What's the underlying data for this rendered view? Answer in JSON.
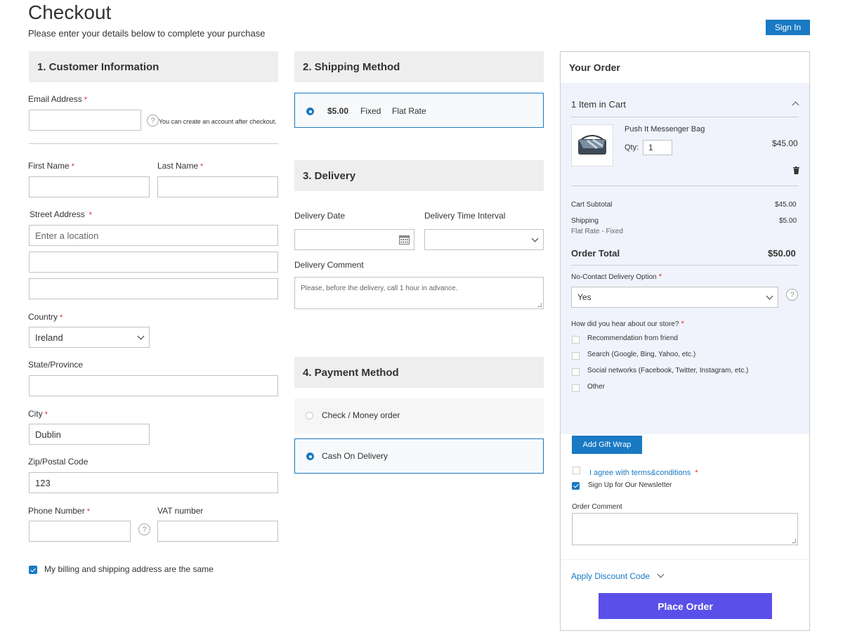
{
  "page": {
    "title": "Checkout",
    "subtitle": "Please enter your details below to complete your purchase",
    "sign_in": "Sign In"
  },
  "customer": {
    "heading": "1. Customer Information",
    "email_label": "Email Address",
    "email_value": "",
    "email_hint": "You can create an account after checkout.",
    "first_name_label": "First Name",
    "last_name_label": "Last Name",
    "street_label": "Street Address",
    "street_placeholder": "Enter a location",
    "country_label": "Country",
    "country_value": "Ireland",
    "state_label": "State/Province",
    "city_label": "City",
    "city_value": "Dublin",
    "zip_label": "Zip/Postal Code",
    "zip_value": "123",
    "phone_label": "Phone Number",
    "vat_label": "VAT number",
    "billing_same_label": "My billing and shipping address are the same",
    "required_mark": "*"
  },
  "shipping": {
    "heading": "2. Shipping Method",
    "price": "$5.00",
    "method": "Fixed",
    "carrier": "Flat Rate"
  },
  "delivery": {
    "heading": "3. Delivery",
    "date_label": "Delivery Date",
    "time_label": "Delivery Time Interval",
    "comment_label": "Delivery Comment",
    "comment_placeholder": "Please, before the delivery, call 1 hour in advance."
  },
  "payment": {
    "heading": "4. Payment Method",
    "options": [
      "Check / Money order",
      "Cash On Delivery"
    ]
  },
  "order": {
    "heading": "Your Order",
    "items_in_cart": "1 Item in Cart",
    "product_name": "Push It Messenger Bag",
    "qty_label": "Qty:",
    "qty_value": "1",
    "product_price": "$45.00",
    "subtotal_label": "Cart Subtotal",
    "subtotal_value": "$45.00",
    "shipping_label": "Shipping",
    "shipping_value": "$5.00",
    "shipping_method": "Flat Rate - Fixed",
    "total_label": "Order Total",
    "total_value": "$50.00",
    "no_contact_label": "No-Contact Delivery Option",
    "no_contact_value": "Yes",
    "hear_label": "How did you hear about our store?",
    "hear_options": [
      "Recommendation from friend",
      "Search (Google, Bing, Yahoo, etc.)",
      "Social networks (Facebook, Twitter, Instagram, etc.)",
      "Other"
    ],
    "gift_wrap": "Add Gift Wrap",
    "terms": "I agree with terms&conditions",
    "newsletter": "Sign Up for Our Newsletter",
    "order_comment_label": "Order Comment",
    "discount": "Apply Discount Code",
    "place_order": "Place Order"
  }
}
